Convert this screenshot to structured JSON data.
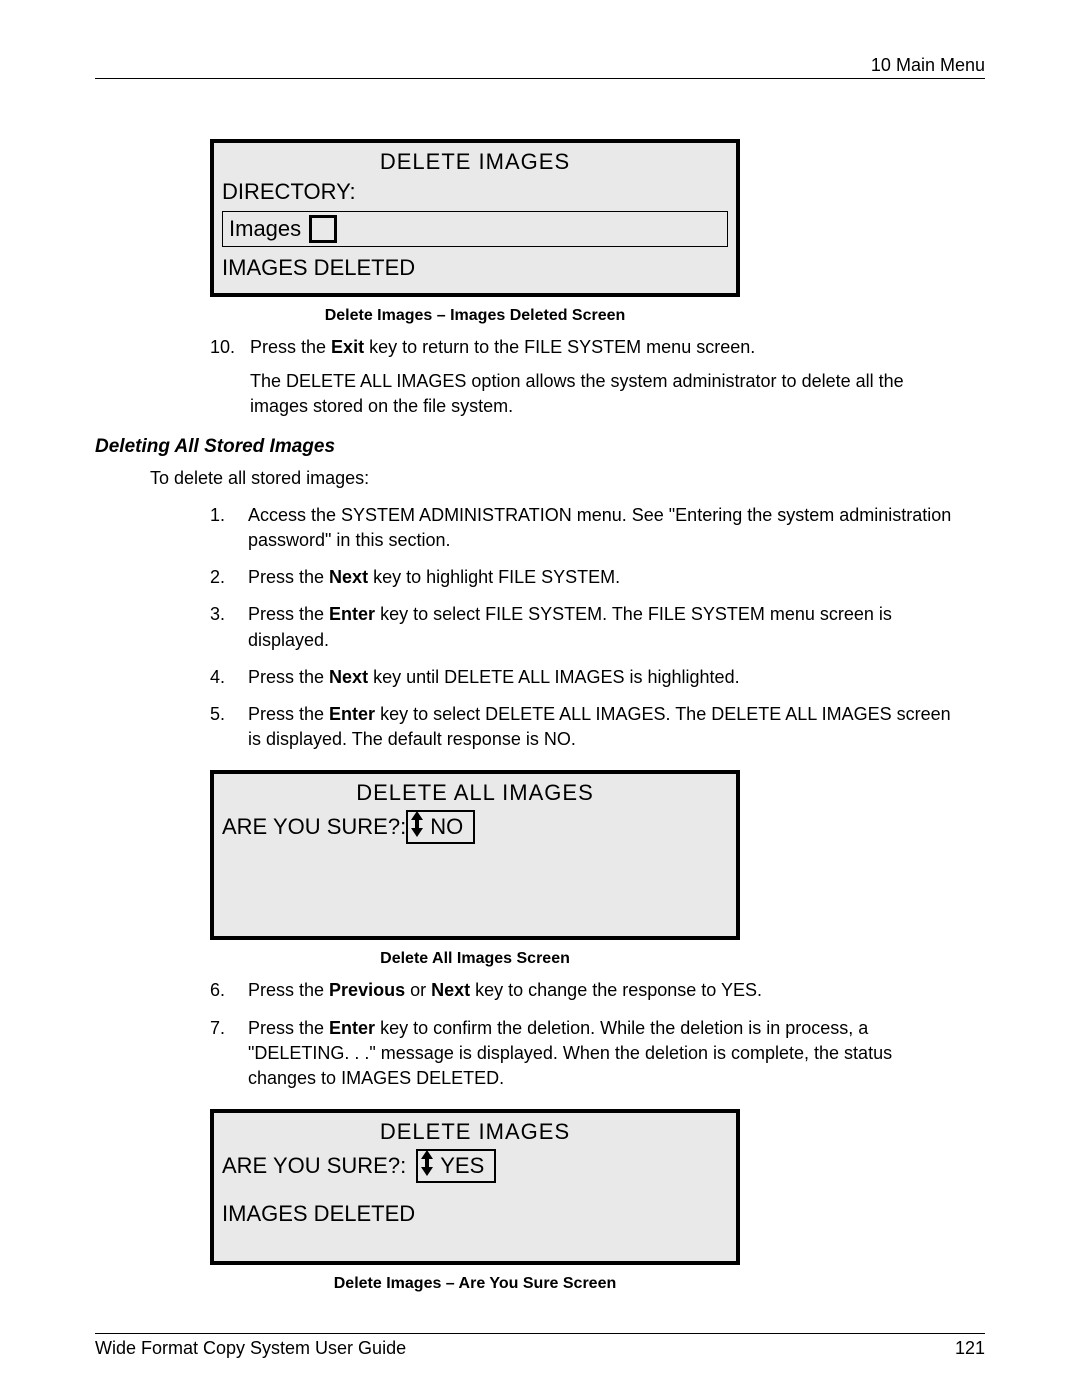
{
  "header": {
    "right": "10 Main Menu"
  },
  "panel1": {
    "title": "DELETE IMAGES",
    "directory_label": "DIRECTORY:",
    "images_label": "Images",
    "status": "IMAGES DELETED"
  },
  "caption1": "Delete Images – Images Deleted Screen",
  "step10": {
    "num": "10.",
    "text_a": "Press the ",
    "exit": "Exit",
    "text_b": " key to return to the FILE SYSTEM menu screen.",
    "para2": "The DELETE ALL IMAGES option allows the system administrator to delete all the images stored on the file system."
  },
  "section_heading": "Deleting All Stored Images",
  "intro": "To delete all stored images:",
  "steps_a": [
    {
      "n": "1.",
      "pre": "Access the SYSTEM ADMINISTRATION menu.  See \"Entering the system administration password\" in this section.",
      "bold": "",
      "post": ""
    },
    {
      "n": "2.",
      "pre": "Press the ",
      "bold": "Next",
      "post": " key to highlight FILE SYSTEM."
    },
    {
      "n": "3.",
      "pre": "Press the ",
      "bold": "Enter",
      "post": " key to select FILE SYSTEM.  The FILE SYSTEM menu screen is displayed."
    },
    {
      "n": "4.",
      "pre": "Press the ",
      "bold": "Next",
      "post": " key until DELETE ALL IMAGES is highlighted."
    },
    {
      "n": "5.",
      "pre": "Press the ",
      "bold": "Enter",
      "post": " key to select DELETE ALL IMAGES.  The DELETE ALL IMAGES screen is displayed.  The default response is NO."
    }
  ],
  "panel2": {
    "title": "DELETE ALL IMAGES",
    "are": "ARE YOU SURE?:",
    "value": "NO"
  },
  "caption2": "Delete All Images Screen",
  "steps_b": [
    {
      "n": "6.",
      "pre": "Press the ",
      "bold": "Previous",
      "mid": " or ",
      "bold2": "Next",
      "post": " key to change the response to YES."
    },
    {
      "n": "7.",
      "pre": "Press the ",
      "bold": "Enter",
      "mid": "",
      "bold2": "",
      "post": " key to confirm the deletion.  While the deletion is in process, a \"DELETING. . .\" message is displayed.  When the deletion is complete, the status changes to IMAGES DELETED."
    }
  ],
  "panel3": {
    "title": "DELETE IMAGES",
    "are": "ARE YOU SURE?:",
    "value": "YES",
    "status": "IMAGES DELETED"
  },
  "caption3": "Delete Images – Are You Sure Screen",
  "footer": {
    "left": "Wide Format Copy System User Guide",
    "right": "121"
  }
}
